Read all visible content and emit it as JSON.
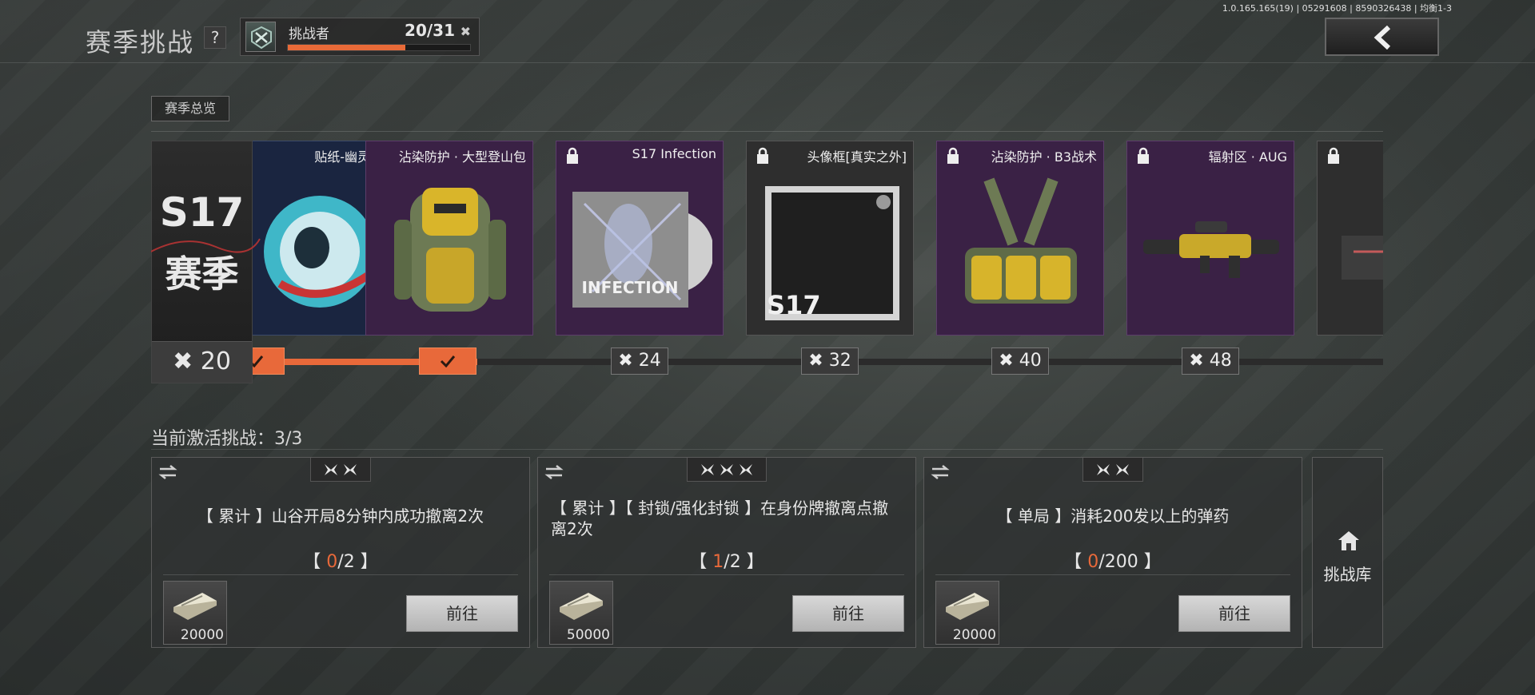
{
  "build_info": "1.0.165.165(19) | 05291608 | 8590326438 | 均衡1-3",
  "header": {
    "title": "赛季挑战",
    "help_label": "?",
    "rank_name": "挑战者",
    "rank_count": "20/31",
    "rank_progress": 0.645
  },
  "overview_tab": "赛季总览",
  "season_badge": {
    "line1": "S17",
    "line2": "赛季",
    "count": "20"
  },
  "rewards": [
    {
      "title": "贴纸-幽灵手雷",
      "locked": false
    },
    {
      "title": "沾染防护 · 大型登山包",
      "locked": false
    },
    {
      "title": "S17 Infection",
      "locked": true,
      "art_text": "INFECTION"
    },
    {
      "title": "头像框[真实之外]",
      "locked": true,
      "art_text": "S17"
    },
    {
      "title": "沾染防护 · B3战术",
      "locked": true
    },
    {
      "title": "辐射区 · AUG",
      "locked": true
    },
    {
      "title": "",
      "locked": true
    }
  ],
  "nodes": [
    {
      "label": "",
      "done": true
    },
    {
      "label": "",
      "done": true
    },
    {
      "label": "24",
      "done": false
    },
    {
      "label": "32",
      "done": false
    },
    {
      "label": "40",
      "done": false
    },
    {
      "label": "48",
      "done": false
    }
  ],
  "track_progress": 0.265,
  "active": {
    "title": "当前激活挑战：3/3"
  },
  "challenges": [
    {
      "stars": 2,
      "desc": "【 累计 】山谷开局8分钟内成功撤离2次",
      "current": "0",
      "total": "/2",
      "reward": "20000",
      "button": "前往"
    },
    {
      "stars": 3,
      "desc": "【 累计 】【 封锁/强化封锁 】在身份牌撤离点撤离2次",
      "current": "1",
      "total": "/2",
      "reward": "50000",
      "button": "前往"
    },
    {
      "stars": 2,
      "desc": "【 单局 】消耗200发以上的弹药",
      "current": "0",
      "total": "/200",
      "reward": "20000",
      "button": "前往"
    }
  ],
  "library": {
    "label": "挑战库"
  },
  "colors": {
    "accent": "#e8693a",
    "card_purple": "#3a2145"
  }
}
